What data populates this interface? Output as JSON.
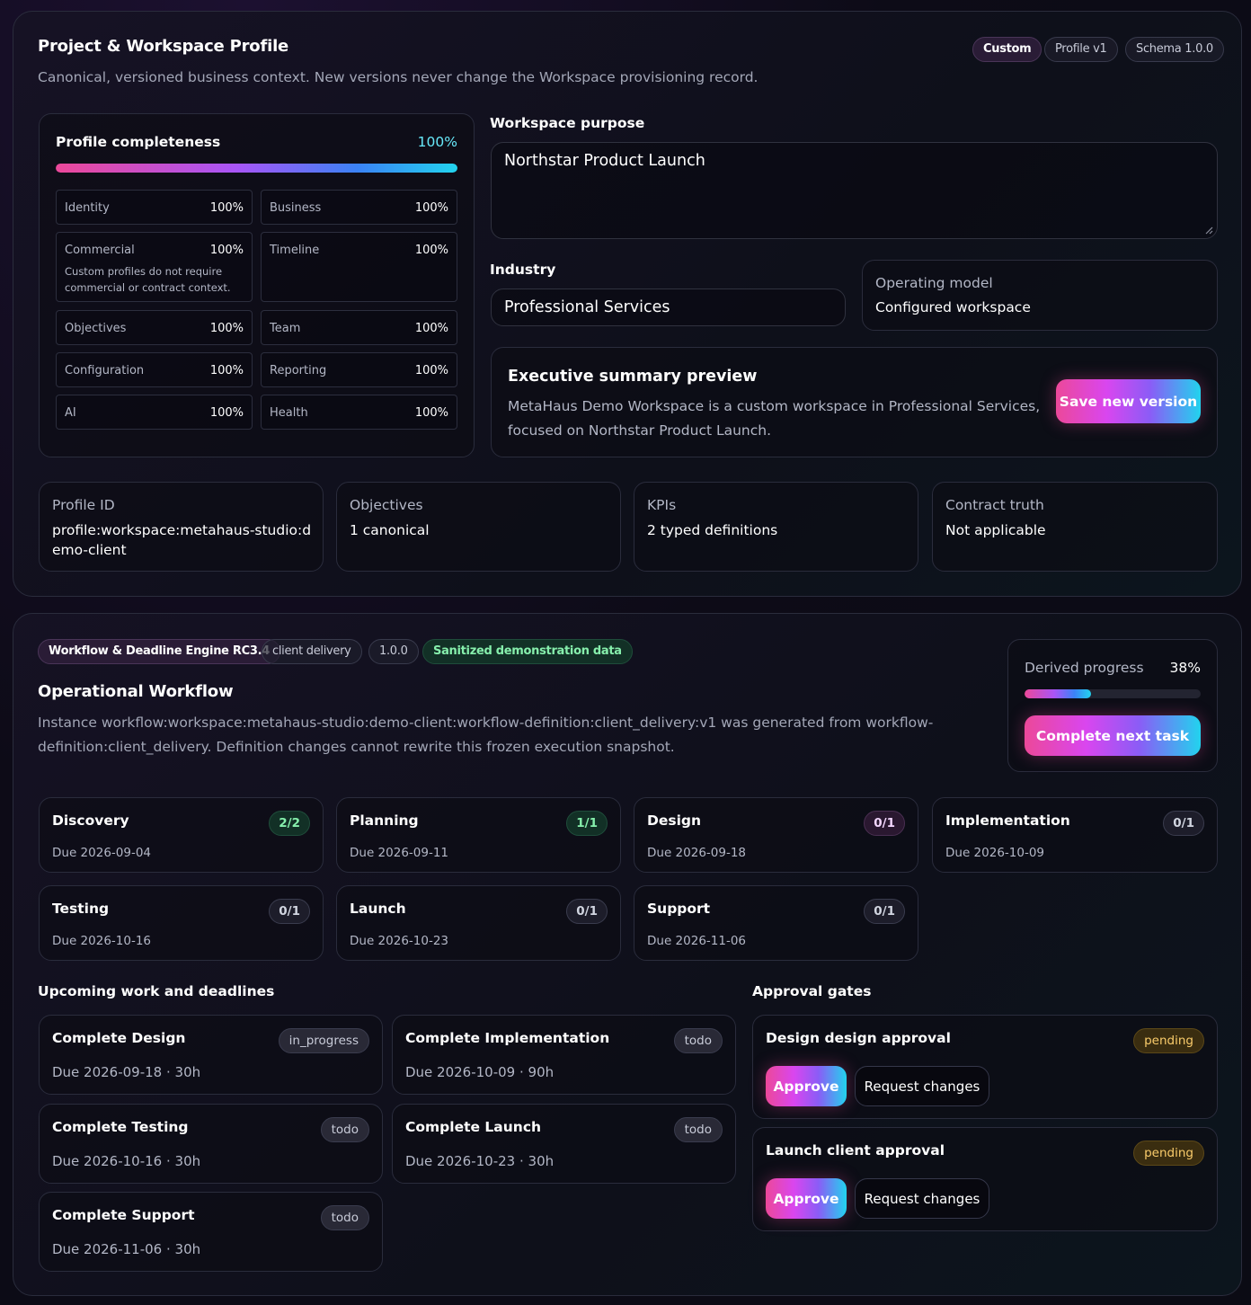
{
  "profile": {
    "title": "Project & Workspace Profile",
    "subtitle": "Canonical, versioned business context. New versions never change the Workspace provisioning record.",
    "badges": [
      "Custom",
      "Profile v1",
      "Schema 1.0.0"
    ],
    "completeness": {
      "label": "Profile completeness",
      "value": "100%",
      "fill": 1.0,
      "sections": [
        {
          "label": "Identity",
          "value": "100%"
        },
        {
          "label": "Business",
          "value": "100%"
        },
        {
          "label": "Commercial",
          "value": "100%",
          "note": "Custom profiles do not require commercial or contract context."
        },
        {
          "label": "Timeline",
          "value": "100%"
        },
        {
          "label": "Objectives",
          "value": "100%"
        },
        {
          "label": "Team",
          "value": "100%"
        },
        {
          "label": "Configuration",
          "value": "100%"
        },
        {
          "label": "Reporting",
          "value": "100%"
        },
        {
          "label": "AI",
          "value": "100%"
        },
        {
          "label": "Health",
          "value": "100%"
        }
      ]
    },
    "purpose_label": "Workspace purpose",
    "purpose_value": "Northstar Product Launch",
    "industry_label": "Industry",
    "industry_value": "Professional Services",
    "operating_model_label": "Operating model",
    "operating_model_value": "Configured workspace",
    "summary_title": "Executive summary preview",
    "summary_text": "MetaHaus Demo Workspace is a custom workspace in Professional Services, focused on Northstar Product Launch.",
    "save_label": "Save new version",
    "stats": [
      {
        "key": "Profile ID",
        "value": "profile:workspace:metahaus-studio:demo-client"
      },
      {
        "key": "Objectives",
        "value": "1 canonical"
      },
      {
        "key": "KPIs",
        "value": "2 typed definitions"
      },
      {
        "key": "Contract truth",
        "value": "Not applicable"
      }
    ]
  },
  "workflow": {
    "badges": [
      "Workflow & Deadline Engine RC3.4",
      "client delivery",
      "1.0.0",
      "Sanitized demonstration data"
    ],
    "title": "Operational Workflow",
    "description": "Instance workflow:workspace:metahaus-studio:demo-client:workflow-definition:client_delivery:v1 was generated from workflow-definition:client_delivery. Definition changes cannot rewrite this frozen execution snapshot.",
    "progress_label": "Derived progress",
    "progress_value": "38%",
    "progress_fill": 0.38,
    "complete_label": "Complete next task",
    "stages": [
      {
        "name": "Discovery",
        "due": "Due 2026-09-04",
        "count": "2/2",
        "state": "done"
      },
      {
        "name": "Planning",
        "due": "Due 2026-09-11",
        "count": "1/1",
        "state": "done"
      },
      {
        "name": "Design",
        "due": "Due 2026-09-18",
        "count": "0/1",
        "state": "active"
      },
      {
        "name": "Implementation",
        "due": "Due 2026-10-09",
        "count": "0/1",
        "state": "todo"
      },
      {
        "name": "Testing",
        "due": "Due 2026-10-16",
        "count": "0/1",
        "state": "todo"
      },
      {
        "name": "Launch",
        "due": "Due 2026-10-23",
        "count": "0/1",
        "state": "todo"
      },
      {
        "name": "Support",
        "due": "Due 2026-11-06",
        "count": "0/1",
        "state": "todo"
      }
    ],
    "upcoming_label": "Upcoming work and deadlines",
    "tasks": [
      {
        "name": "Complete Design",
        "due": "Due 2026-09-18 · 30h",
        "status": "in_progress"
      },
      {
        "name": "Complete Implementation",
        "due": "Due 2026-10-09 · 90h",
        "status": "todo"
      },
      {
        "name": "Complete Testing",
        "due": "Due 2026-10-16 · 30h",
        "status": "todo"
      },
      {
        "name": "Complete Launch",
        "due": "Due 2026-10-23 · 30h",
        "status": "todo"
      },
      {
        "name": "Complete Support",
        "due": "Due 2026-11-06 · 30h",
        "status": "todo"
      }
    ],
    "approvals_label": "Approval gates",
    "approvals": [
      {
        "name": "Design design approval",
        "status": "pending",
        "approve": "Approve",
        "request": "Request changes"
      },
      {
        "name": "Launch client approval",
        "status": "pending",
        "approve": "Approve",
        "request": "Request changes"
      }
    ]
  }
}
